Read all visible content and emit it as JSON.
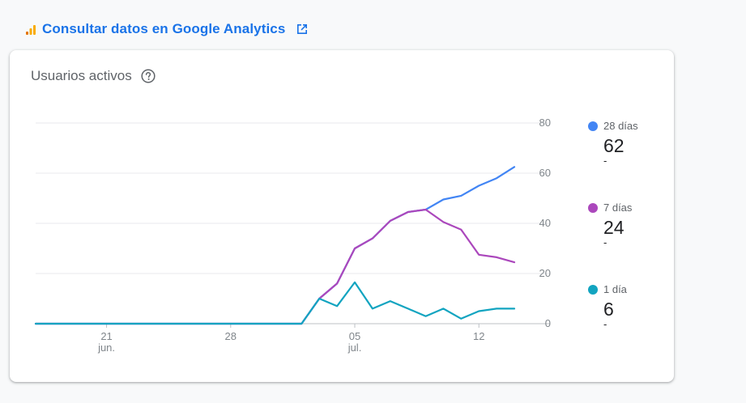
{
  "header": {
    "link_label": "Consultar datos en Google Analytics",
    "icon": "analytics-icon",
    "external_icon": "open-in-new-icon"
  },
  "card": {
    "title": "Usuarios activos",
    "help_icon": "help-circle-icon"
  },
  "legend": [
    {
      "name": "28 días",
      "value": "62",
      "change": "-",
      "color": "#4285f4"
    },
    {
      "name": "7 días",
      "value": "24",
      "change": "-",
      "color": "#ab47bc"
    },
    {
      "name": "1 día",
      "value": "6",
      "change": "-",
      "color": "#12a4c0"
    }
  ],
  "chart_data": {
    "type": "line",
    "x_start": "2024-06-17",
    "x_end": "2024-07-14",
    "x_ticks": [
      {
        "date": "2024-06-21",
        "label": "21",
        "sublabel": "jun."
      },
      {
        "date": "2024-06-28",
        "label": "28",
        "sublabel": ""
      },
      {
        "date": "2024-07-05",
        "label": "05",
        "sublabel": "jul."
      },
      {
        "date": "2024-07-12",
        "label": "12",
        "sublabel": ""
      }
    ],
    "y_ticks": [
      0,
      20,
      40,
      60,
      80
    ],
    "ylim": [
      0,
      80
    ],
    "grid": true,
    "series": [
      {
        "name": "28 días",
        "color": "#4285f4",
        "points": [
          [
            "2024-06-17",
            0
          ],
          [
            "2024-06-18",
            0
          ],
          [
            "2024-06-19",
            0
          ],
          [
            "2024-06-20",
            0
          ],
          [
            "2024-06-21",
            0
          ],
          [
            "2024-06-22",
            0
          ],
          [
            "2024-06-23",
            0
          ],
          [
            "2024-06-24",
            0
          ],
          [
            "2024-06-25",
            0
          ],
          [
            "2024-06-26",
            0
          ],
          [
            "2024-06-27",
            0
          ],
          [
            "2024-06-28",
            0
          ],
          [
            "2024-06-29",
            0
          ],
          [
            "2024-06-30",
            0
          ],
          [
            "2024-07-01",
            0
          ],
          [
            "2024-07-02",
            0
          ],
          [
            "2024-07-03",
            10
          ],
          [
            "2024-07-04",
            16
          ],
          [
            "2024-07-05",
            30
          ],
          [
            "2024-07-06",
            34
          ],
          [
            "2024-07-07",
            41
          ],
          [
            "2024-07-08",
            44.5
          ],
          [
            "2024-07-09",
            45.5
          ],
          [
            "2024-07-10",
            49.5
          ],
          [
            "2024-07-11",
            51
          ],
          [
            "2024-07-12",
            55
          ],
          [
            "2024-07-13",
            58
          ],
          [
            "2024-07-14",
            62.5
          ]
        ]
      },
      {
        "name": "7 días",
        "color": "#ab47bc",
        "points": [
          [
            "2024-06-17",
            0
          ],
          [
            "2024-06-18",
            0
          ],
          [
            "2024-06-19",
            0
          ],
          [
            "2024-06-20",
            0
          ],
          [
            "2024-06-21",
            0
          ],
          [
            "2024-06-22",
            0
          ],
          [
            "2024-06-23",
            0
          ],
          [
            "2024-06-24",
            0
          ],
          [
            "2024-06-25",
            0
          ],
          [
            "2024-06-26",
            0
          ],
          [
            "2024-06-27",
            0
          ],
          [
            "2024-06-28",
            0
          ],
          [
            "2024-06-29",
            0
          ],
          [
            "2024-06-30",
            0
          ],
          [
            "2024-07-01",
            0
          ],
          [
            "2024-07-02",
            0
          ],
          [
            "2024-07-03",
            10
          ],
          [
            "2024-07-04",
            16
          ],
          [
            "2024-07-05",
            30
          ],
          [
            "2024-07-06",
            34
          ],
          [
            "2024-07-07",
            41
          ],
          [
            "2024-07-08",
            44.5
          ],
          [
            "2024-07-09",
            45.5
          ],
          [
            "2024-07-10",
            40.5
          ],
          [
            "2024-07-11",
            37.5
          ],
          [
            "2024-07-12",
            27.5
          ],
          [
            "2024-07-13",
            26.5
          ],
          [
            "2024-07-14",
            24.5
          ]
        ]
      },
      {
        "name": "1 día",
        "color": "#12a4c0",
        "points": [
          [
            "2024-06-17",
            0
          ],
          [
            "2024-06-18",
            0
          ],
          [
            "2024-06-19",
            0
          ],
          [
            "2024-06-20",
            0
          ],
          [
            "2024-06-21",
            0
          ],
          [
            "2024-06-22",
            0
          ],
          [
            "2024-06-23",
            0
          ],
          [
            "2024-06-24",
            0
          ],
          [
            "2024-06-25",
            0
          ],
          [
            "2024-06-26",
            0
          ],
          [
            "2024-06-27",
            0
          ],
          [
            "2024-06-28",
            0
          ],
          [
            "2024-06-29",
            0
          ],
          [
            "2024-06-30",
            0
          ],
          [
            "2024-07-01",
            0
          ],
          [
            "2024-07-02",
            0
          ],
          [
            "2024-07-03",
            10
          ],
          [
            "2024-07-04",
            7
          ],
          [
            "2024-07-05",
            16.5
          ],
          [
            "2024-07-06",
            6
          ],
          [
            "2024-07-07",
            9
          ],
          [
            "2024-07-08",
            6
          ],
          [
            "2024-07-09",
            3
          ],
          [
            "2024-07-10",
            6
          ],
          [
            "2024-07-11",
            2
          ],
          [
            "2024-07-12",
            5
          ],
          [
            "2024-07-13",
            6
          ],
          [
            "2024-07-14",
            6
          ]
        ]
      }
    ]
  }
}
